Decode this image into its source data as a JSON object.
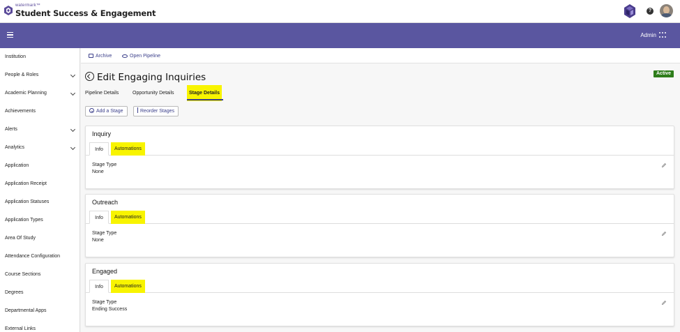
{
  "header": {
    "brand_small": "watermark™",
    "brand_title": "Student Success & Engagement"
  },
  "navbar": {
    "user_label": "Admin"
  },
  "sidebar": {
    "items": [
      {
        "label": "Institution",
        "expandable": false
      },
      {
        "label": "People & Roles",
        "expandable": true
      },
      {
        "label": "Academic Planning",
        "expandable": true
      },
      {
        "label": "Achievements",
        "expandable": false
      },
      {
        "label": "Alerts",
        "expandable": true
      },
      {
        "label": "Analytics",
        "expandable": true
      },
      {
        "label": "Application",
        "expandable": false
      },
      {
        "label": "Application Receipt",
        "expandable": false
      },
      {
        "label": "Application Statuses",
        "expandable": false
      },
      {
        "label": "Application Types",
        "expandable": false
      },
      {
        "label": "Area Of Study",
        "expandable": false
      },
      {
        "label": "Attendance Configuration",
        "expandable": false
      },
      {
        "label": "Course Sections",
        "expandable": false
      },
      {
        "label": "Degrees",
        "expandable": false
      },
      {
        "label": "Departmental Apps",
        "expandable": false
      },
      {
        "label": "External Links",
        "expandable": false
      }
    ]
  },
  "actions": {
    "archive": "Archive",
    "open_pipeline": "Open Pipeline"
  },
  "page": {
    "title": "Edit Engaging Inquiries",
    "status": "Active",
    "tabs": [
      "Pipeline Details",
      "Opportunity Details",
      "Stage Details"
    ],
    "active_tab": "Stage Details",
    "add_stage": "Add a Stage",
    "reorder_stages": "Reorder Stages"
  },
  "stages": [
    {
      "name": "Inquiry",
      "tab_info": "Info",
      "tab_automations": "Automations",
      "field_label": "Stage Type",
      "field_value": "None"
    },
    {
      "name": "Outreach",
      "tab_info": "Info",
      "tab_automations": "Automations",
      "field_label": "Stage Type",
      "field_value": "None"
    },
    {
      "name": "Engaged",
      "tab_info": "Info",
      "tab_automations": "Automations",
      "field_label": "Stage Type",
      "field_value": "Ending Success"
    }
  ],
  "colors": {
    "nav_purple": "#5a56a0",
    "highlight_yellow": "#f8f400",
    "active_green": "#2e7d1a",
    "link_blue": "#3b3f8a"
  }
}
